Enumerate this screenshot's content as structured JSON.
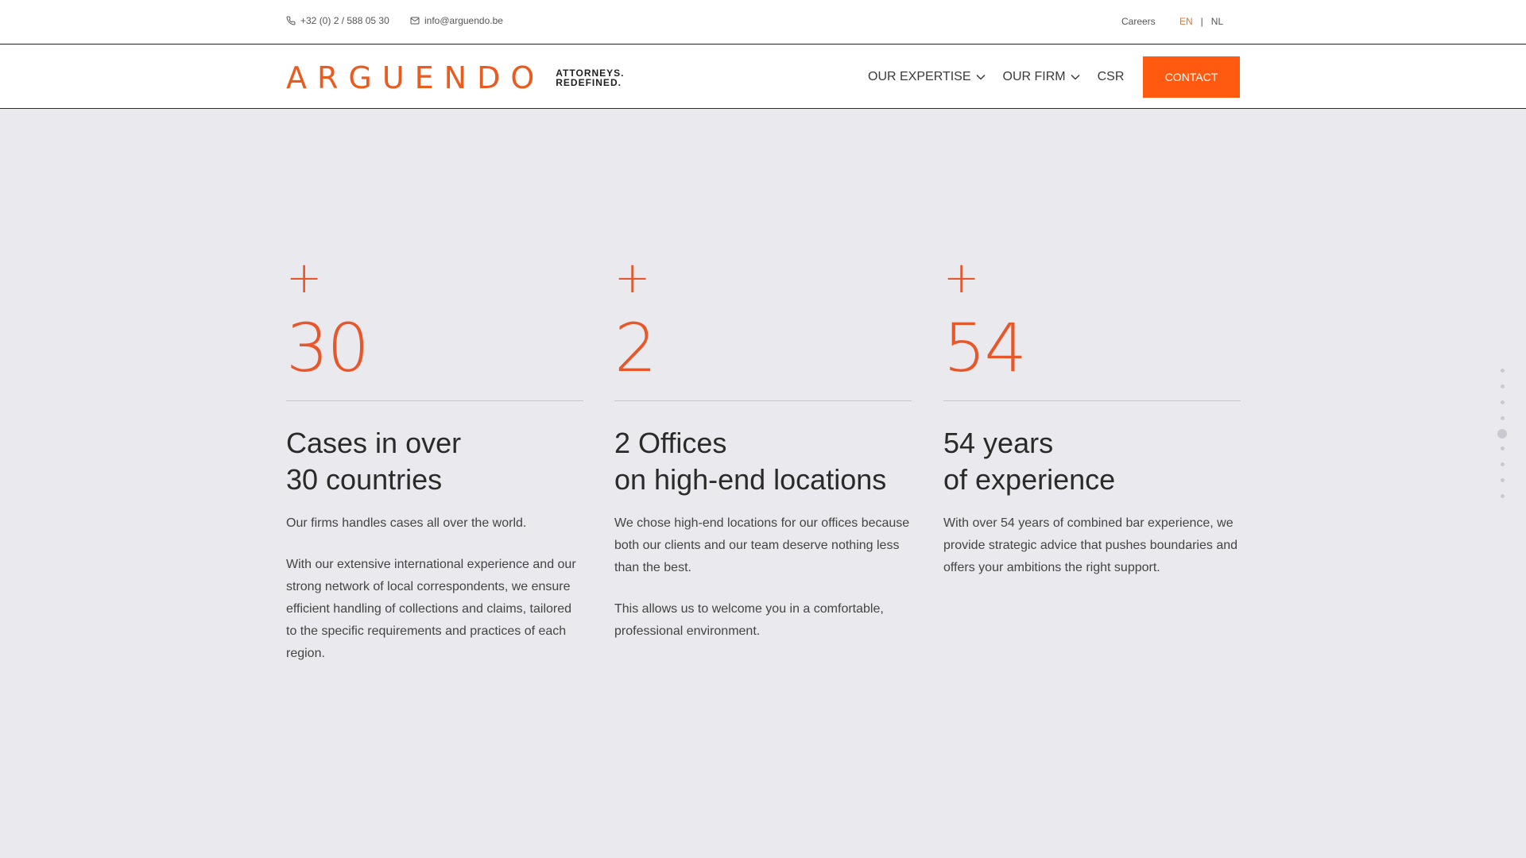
{
  "topbar": {
    "phone": "+32 (0) 2 / 588 05 30",
    "email": "info@arguendo.be",
    "careers": "Careers",
    "lang_en": "EN",
    "lang_sep": "|",
    "lang_nl": "NL"
  },
  "header": {
    "logo_word": "ARGUENDO",
    "logo_tag_line1": "ATTORNEYS.",
    "logo_tag_line2": "REDEFINED.",
    "nav": {
      "expertise": "OUR EXPERTISE",
      "firm": "OUR FIRM",
      "csr": "CSR"
    },
    "contact_button": "CONTACT"
  },
  "stats": [
    {
      "plus": "+",
      "number": "30",
      "title_line1": "Cases in over",
      "title_line2": "30 countries",
      "paragraphs": [
        "Our firms handles cases all over the world.",
        "With our extensive international experience and our strong network of local correspondents, we ensure efficient handling of collections and claims, tailored to the specific requirements and practices of each region."
      ]
    },
    {
      "plus": "+",
      "number": "2",
      "title_line1": "2 Offices",
      "title_line2": "on high-end locations",
      "paragraphs": [
        "We chose high-end locations for our offices because both our clients and our team deserve nothing less than the best.",
        "This allows us to welcome you in a comfortable, professional environment."
      ]
    },
    {
      "plus": "+",
      "number": "54",
      "title_line1": "54 years",
      "title_line2": "of experience",
      "paragraphs": [
        "With over 54 years of combined bar experience, we provide strategic advice that pushes boundaries and offers your ambitions the right support."
      ]
    }
  ],
  "slide_nav": {
    "total": 9,
    "active_index": 4
  },
  "colors": {
    "accent": "#ff5a0f",
    "accent_text": "#e8572a",
    "background": "#e9e9ee"
  }
}
